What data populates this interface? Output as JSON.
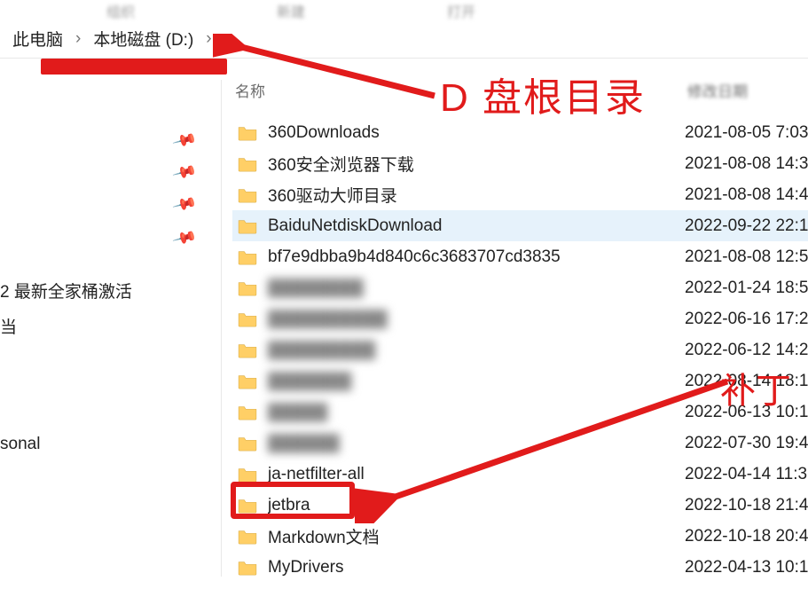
{
  "ribbon": {
    "a": "组织",
    "b": "新建",
    "c": "打开"
  },
  "breadcrumb": {
    "seg1": "此电脑",
    "seg2": "本地磁盘 (D:)"
  },
  "columns": {
    "name": "名称",
    "date": "修改日期"
  },
  "sidebar": {
    "item1": "2 最新全家桶激活",
    "item2": "当",
    "item3": "sonal"
  },
  "files": [
    {
      "name": "360Downloads",
      "date": "2021-08-05 7:03",
      "blur": false,
      "sel": false
    },
    {
      "name": "360安全浏览器下载",
      "date": "2021-08-08 14:3",
      "blur": false,
      "sel": false
    },
    {
      "name": "360驱动大师目录",
      "date": "2021-08-08 14:4",
      "blur": false,
      "sel": false
    },
    {
      "name": "BaiduNetdiskDownload",
      "date": "2022-09-22 22:1",
      "blur": false,
      "sel": true
    },
    {
      "name": "bf7e9dbba9b4d840c6c3683707cd3835",
      "date": "2021-08-08 12:5",
      "blur": false,
      "sel": false
    },
    {
      "name": "████████",
      "date": "2022-01-24 18:5",
      "blur": true,
      "sel": false
    },
    {
      "name": "██████████",
      "date": "2022-06-16 17:2",
      "blur": true,
      "sel": false
    },
    {
      "name": "█████████",
      "date": "2022-06-12 14:2",
      "blur": true,
      "sel": false
    },
    {
      "name": "███████",
      "date": "2022-08-14 18:1",
      "blur": true,
      "sel": false
    },
    {
      "name": "█████",
      "date": "2022-06-13 10:1",
      "blur": true,
      "sel": false
    },
    {
      "name": "██████",
      "date": "2022-07-30 19:4",
      "blur": true,
      "sel": false
    },
    {
      "name": "ja-netfilter-all",
      "date": "2022-04-14 11:3",
      "blur": false,
      "sel": false
    },
    {
      "name": "jetbra",
      "date": "2022-10-18 21:4",
      "blur": false,
      "sel": false
    },
    {
      "name": "Markdown文档",
      "date": "2022-10-18 20:4",
      "blur": false,
      "sel": false
    },
    {
      "name": "MyDrivers",
      "date": "2022-04-13 10:1",
      "blur": false,
      "sel": false
    }
  ],
  "annotations": {
    "title": "D 盘根目录",
    "patch": "补丁"
  },
  "colors": {
    "accent_red": "#e11b1b",
    "selection_blue": "#e6f2fb",
    "folder_yellow": "#ffcf66"
  }
}
